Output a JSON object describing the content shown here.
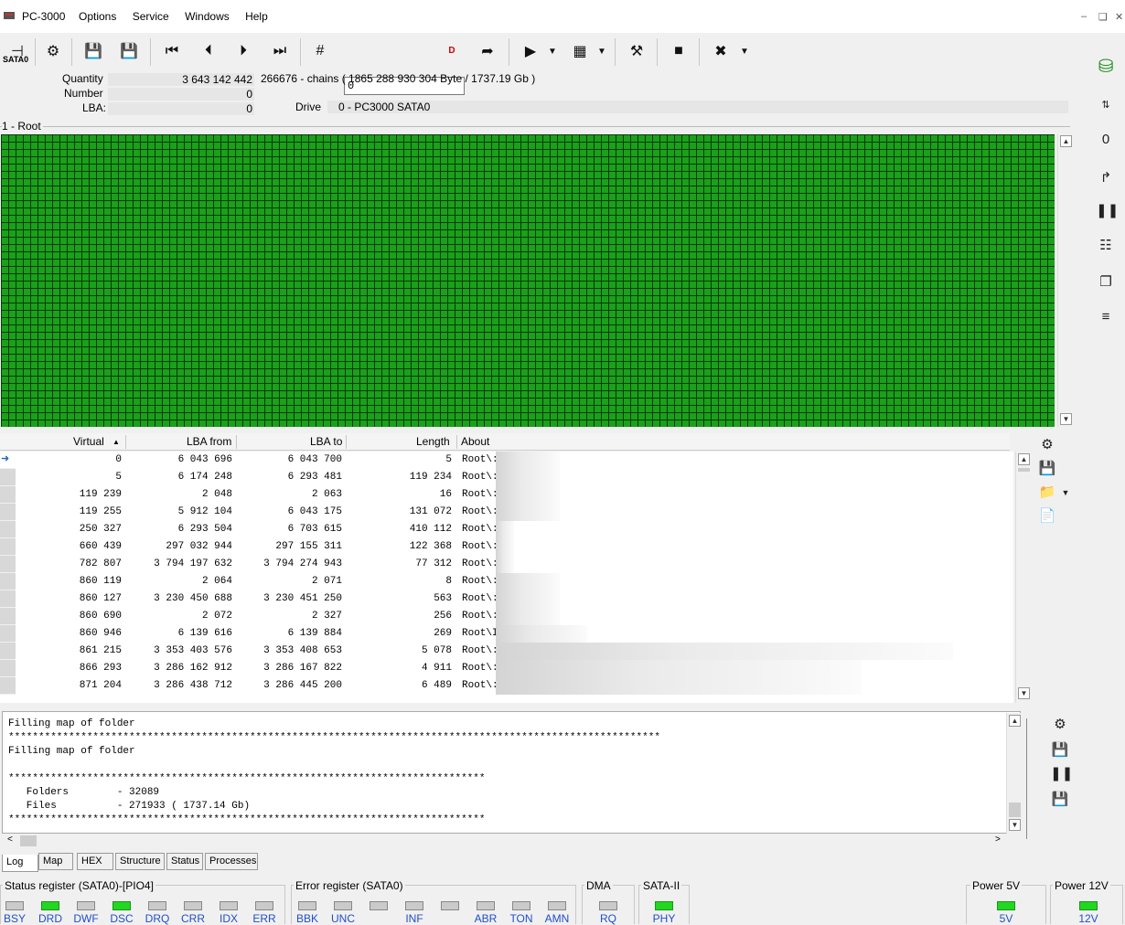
{
  "app": {
    "title": "PC-3000",
    "menu": [
      "Options",
      "Service",
      "Windows",
      "Help"
    ]
  },
  "toolbar": {
    "port_label": "SATA0",
    "lba_input_value": "0",
    "icons": [
      "sata-port-icon",
      "settings-cycle-icon",
      "save-icon",
      "save-as-icon",
      "first-icon",
      "prev-icon",
      "next-icon",
      "last-icon",
      "grid-hash-icon",
      "goto-icon",
      "play-icon",
      "dropdown-icon",
      "map-grid-icon",
      "dropdown-icon",
      "tools-icon",
      "stop-icon",
      "exit-icon",
      "dropdown-icon"
    ]
  },
  "info": {
    "quantity_label": "Quantity",
    "quantity_value": "3 643 142 442",
    "quantity_extra": "266676 - chains  ( 1865 288 930 304 Byte /  1737.19 Gb )",
    "number_label": "Number",
    "number_value": "0",
    "lba_label": "LBA:",
    "lba_value": "0",
    "drive_label": "Drive",
    "drive_value": "0 - PC3000 SATA0"
  },
  "map": {
    "root_label": "1 - Root",
    "color": "#1aa01a"
  },
  "table": {
    "headers": [
      "Virtual",
      "LBA from",
      "LBA to",
      "Length",
      "About"
    ],
    "rows": [
      {
        "virtual": "0",
        "lba_from": "6 043 696",
        "lba_to": "6 043 700",
        "length": "5",
        "about": "Root\\:"
      },
      {
        "virtual": "5",
        "lba_from": "6 174 248",
        "lba_to": "6 293 481",
        "length": "119 234",
        "about": "Root\\:"
      },
      {
        "virtual": "119 239",
        "lba_from": "2 048",
        "lba_to": "2 063",
        "length": "16",
        "about": "Root\\:"
      },
      {
        "virtual": "119 255",
        "lba_from": "5 912 104",
        "lba_to": "6 043 175",
        "length": "131 072",
        "about": "Root\\:"
      },
      {
        "virtual": "250 327",
        "lba_from": "6 293 504",
        "lba_to": "6 703 615",
        "length": "410 112",
        "about": "Root\\:"
      },
      {
        "virtual": "660 439",
        "lba_from": "297 032 944",
        "lba_to": "297 155 311",
        "length": "122 368",
        "about": "Root\\:"
      },
      {
        "virtual": "782 807",
        "lba_from": "3 794 197 632",
        "lba_to": "3 794 274 943",
        "length": "77 312",
        "about": "Root\\:"
      },
      {
        "virtual": "860 119",
        "lba_from": "2 064",
        "lba_to": "2 071",
        "length": "8",
        "about": "Root\\:"
      },
      {
        "virtual": "860 127",
        "lba_from": "3 230 450 688",
        "lba_to": "3 230 451 250",
        "length": "563",
        "about": "Root\\:"
      },
      {
        "virtual": "860 690",
        "lba_from": "2 072",
        "lba_to": "2 327",
        "length": "256",
        "about": "Root\\:"
      },
      {
        "virtual": "860 946",
        "lba_from": "6 139 616",
        "lba_to": "6 139 884",
        "length": "269",
        "about": "Root\\I"
      },
      {
        "virtual": "861 215",
        "lba_from": "3 353 403 576",
        "lba_to": "3 353 408 653",
        "length": "5 078",
        "about": "Root\\:"
      },
      {
        "virtual": "866 293",
        "lba_from": "3 286 162 912",
        "lba_to": "3 286 167 822",
        "length": "4 911",
        "about": "Root\\:"
      },
      {
        "virtual": "871 204",
        "lba_from": "3 286 438 712",
        "lba_to": "3 286 445 200",
        "length": "6 489",
        "about": "Root\\:"
      }
    ]
  },
  "log": {
    "lines": [
      "Filling map of folder",
      "************************************************************************************************************",
      "Filling map of folder",
      "",
      "*******************************************************************************",
      "   Folders        - 32089",
      "   Files          - 271933 ( 1737.14 Gb)",
      "*******************************************************************************"
    ]
  },
  "tabs": [
    "Log",
    "Map",
    "HEX",
    "Structure",
    "Status",
    "Processes"
  ],
  "status": {
    "status_register_title": "Status register (SATA0)-[PIO4]",
    "status_bits": [
      {
        "label": "BSY",
        "on": false
      },
      {
        "label": "DRD",
        "on": true
      },
      {
        "label": "DWF",
        "on": false
      },
      {
        "label": "DSC",
        "on": true
      },
      {
        "label": "DRQ",
        "on": false
      },
      {
        "label": "CRR",
        "on": false
      },
      {
        "label": "IDX",
        "on": false
      },
      {
        "label": "ERR",
        "on": false
      }
    ],
    "error_register_title": "Error register (SATA0)",
    "error_bits": [
      {
        "label": "BBK",
        "on": false
      },
      {
        "label": "UNC",
        "on": false
      },
      {
        "label": "",
        "on": false
      },
      {
        "label": "INF",
        "on": false
      },
      {
        "label": "",
        "on": false
      },
      {
        "label": "ABR",
        "on": false
      },
      {
        "label": "TON",
        "on": false
      },
      {
        "label": "AMN",
        "on": false
      }
    ],
    "dma_title": "DMA",
    "dma_bit": {
      "label": "RQ",
      "on": false
    },
    "sata_title": "SATA-II",
    "sata_bit": {
      "label": "PHY",
      "on": true
    },
    "power5_title": "Power 5V",
    "power5_bit": {
      "label": "5V",
      "on": true
    },
    "power12_title": "Power 12V",
    "power12_bit": {
      "label": "12V",
      "on": true
    }
  }
}
